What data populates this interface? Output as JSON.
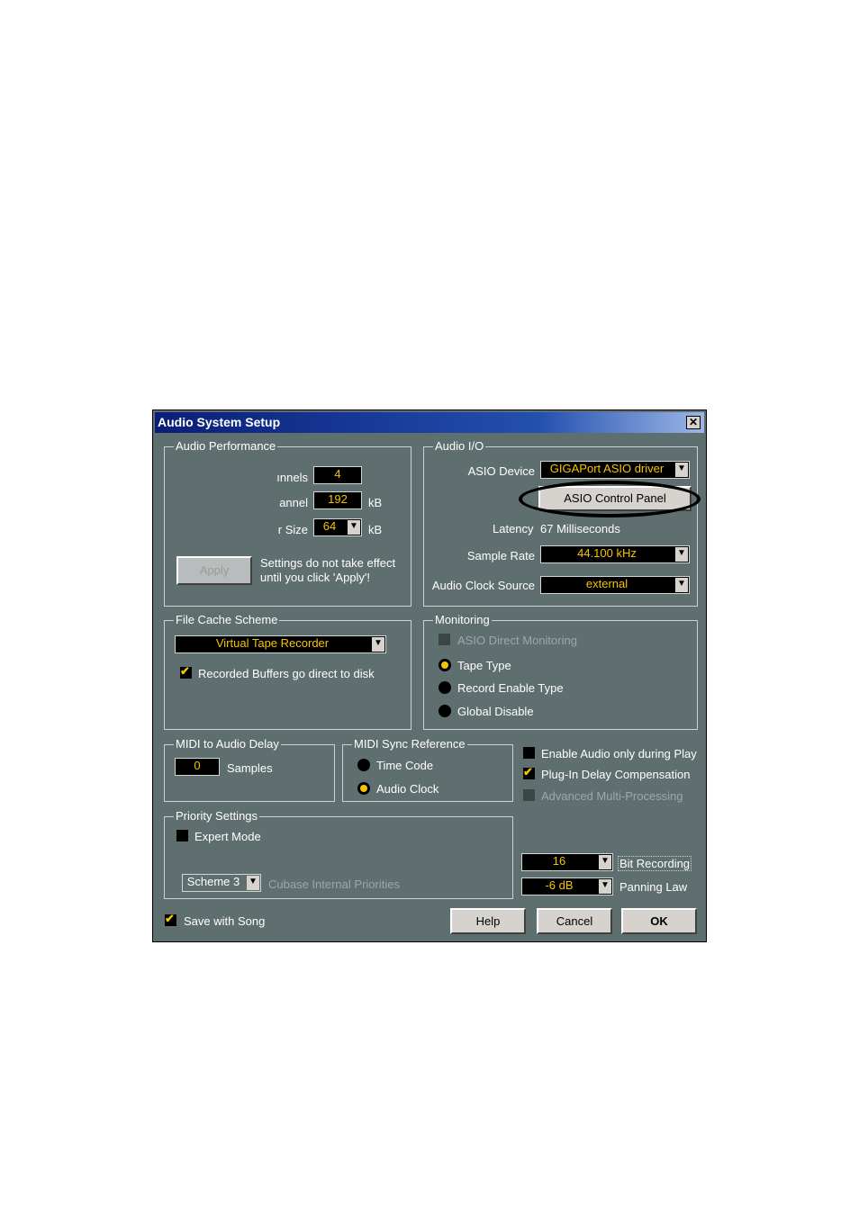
{
  "dialog": {
    "title": "Audio System Setup",
    "close_label": "✕"
  },
  "audio_performance": {
    "legend": "Audio Performance",
    "channels_label": "ınnels",
    "channels_value": "4",
    "buffer_label": "annel",
    "buffer_value": "192",
    "buffer_unit": "kB",
    "size_label": "r Size",
    "size_value": "64",
    "size_unit": "kB",
    "apply_label": "Apply",
    "apply_note_1": "Settings do not take effect",
    "apply_note_2": "until you click 'Apply'!"
  },
  "audio_io": {
    "legend": "Audio I/O",
    "asio_device_label": "ASIO Device",
    "asio_device_value": "GIGAPort ASIO driver",
    "control_panel_label": "ASIO Control Panel",
    "latency_label": "Latency",
    "latency_value": "67 Milliseconds",
    "sample_rate_label": "Sample Rate",
    "sample_rate_value": "44.100 kHz",
    "clock_source_label": "Audio Clock Source",
    "clock_source_value": "external"
  },
  "file_cache": {
    "legend": "File Cache Scheme",
    "scheme_value": "Virtual Tape Recorder",
    "recorded_buffers_label": "Recorded Buffers go direct to disk",
    "recorded_buffers_checked": true
  },
  "monitoring": {
    "legend": "Monitoring",
    "asio_direct_label": "ASIO Direct Monitoring",
    "options": [
      "Tape Type",
      "Record Enable Type",
      "Global Disable"
    ],
    "selected": "Tape Type"
  },
  "midi_delay": {
    "legend": "MIDI to Audio Delay",
    "value": "0",
    "unit": "Samples"
  },
  "midi_sync": {
    "legend": "MIDI Sync Reference",
    "options": [
      "Time Code",
      "Audio Clock"
    ],
    "selected": "Audio Clock"
  },
  "options": {
    "enable_audio_label": "Enable Audio only during Play",
    "enable_audio_checked": false,
    "plugin_delay_label": "Plug-In Delay Compensation",
    "plugin_delay_checked": true,
    "advanced_mp_label": "Advanced Multi-Processing",
    "advanced_mp_checked": false
  },
  "priority": {
    "legend": "Priority Settings",
    "expert_mode_label": "Expert Mode",
    "expert_mode_checked": false,
    "scheme_value": "Scheme 3",
    "scheme_label": "Cubase Internal Priorities"
  },
  "recording": {
    "bits_value": "16",
    "bits_label": "Bit Recording",
    "panning_value": "-6 dB",
    "panning_label": "Panning Law"
  },
  "footer": {
    "save_with_song_label": "Save with Song",
    "save_with_song_checked": true,
    "help_label": "Help",
    "cancel_label": "Cancel",
    "ok_label": "OK"
  },
  "colors": {
    "dialog_bg": "#5f6f6f",
    "value_text": "#f5c400",
    "title_gradient_start": "#0a1e78"
  }
}
